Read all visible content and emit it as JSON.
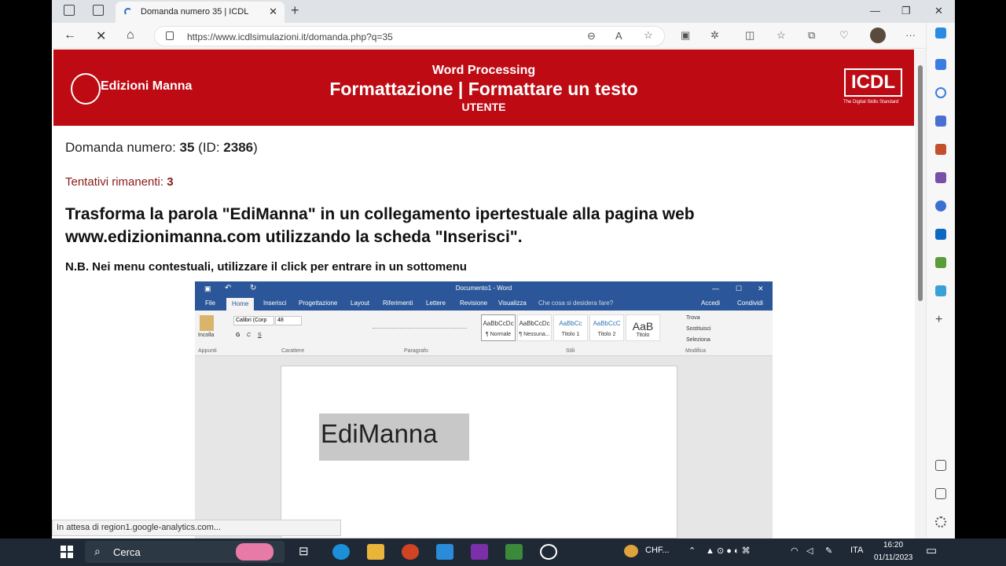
{
  "browser": {
    "tab_title": "Domanda numero 35 | ICDL",
    "url": "https://www.icdlsimulazioni.it/domanda.php?q=35",
    "status": "In attesa di region1.google-analytics.com..."
  },
  "banner": {
    "logo": "Edizioni Manna",
    "top": "Word Processing",
    "title": "Formattazione  |  Formattare un testo",
    "sub": "UTENTE",
    "icdl": "ICDL",
    "icdl_sub": "The Digital Skills Standard"
  },
  "question": {
    "number_label": "Domanda numero: ",
    "number": "35",
    "id_label": " (ID: ",
    "id": "2386",
    "id_close": ")",
    "tries_label": "Tentativi rimanenti: ",
    "tries": "3",
    "text": "Trasforma la parola \"EdiManna\" in un collegamento ipertestuale alla pagina web www.edizionimanna.com utilizzando la scheda \"Inserisci\".",
    "note": "N.B. Nei menu contestuali, utilizzare il click per entrare in un sottomenu"
  },
  "word": {
    "title": "Documento1 - Word",
    "tabs": [
      "File",
      "Home",
      "Inserisci",
      "Progettazione",
      "Layout",
      "Riferimenti",
      "Lettere",
      "Revisione",
      "Visualizza"
    ],
    "tellme": "Che cosa si desidera fare?",
    "access": "Accedi",
    "share": "Condividi",
    "groups": [
      "Appunti",
      "Carattere",
      "Paragrafo",
      "Stili",
      "Modifica"
    ],
    "paste": "Incolla",
    "font": "Calibri (Corp",
    "size": "48",
    "styles": [
      {
        "prev": "AaBbCcDc",
        "name": "¶ Normale"
      },
      {
        "prev": "AaBbCcDc",
        "name": "¶ Nessuna..."
      },
      {
        "prev": "AaBbCc",
        "name": "Titolo 1"
      },
      {
        "prev": "AaBbCcC",
        "name": "Titolo 2"
      },
      {
        "prev": "AaB",
        "name": "Titolo"
      }
    ],
    "edit": [
      "Trova",
      "Sostituisci",
      "Seleziona"
    ],
    "doc_text": "EdiManna"
  },
  "taskbar": {
    "search": "Cerca",
    "weather": "CHF...",
    "lang": "ITA",
    "time": "16:20",
    "date": "01/11/2023"
  }
}
